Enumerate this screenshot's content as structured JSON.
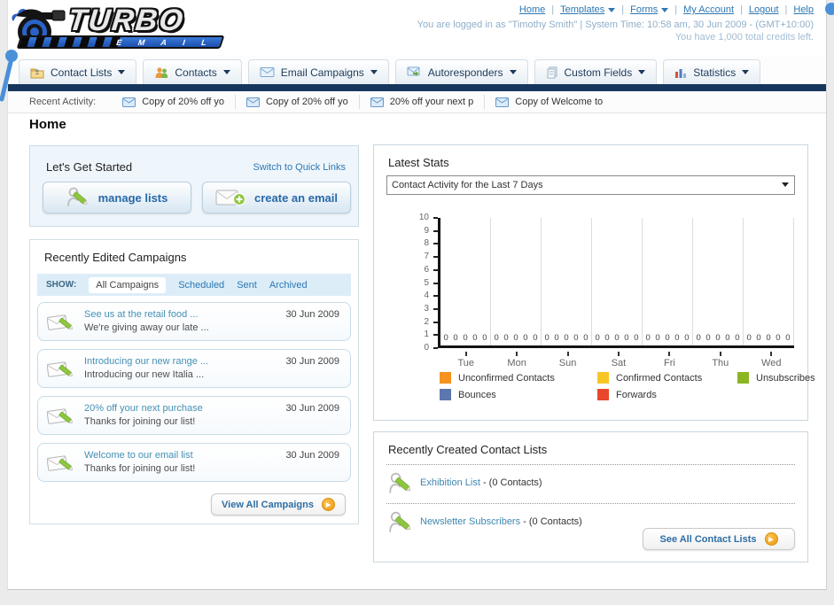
{
  "header": {
    "logo": {
      "line1": "TURBO",
      "line2": "E M A I L"
    },
    "nav": [
      {
        "label": "Home",
        "dropdown": false
      },
      {
        "label": "Templates",
        "dropdown": true
      },
      {
        "label": "Forms",
        "dropdown": true
      },
      {
        "label": "My Account",
        "dropdown": false
      },
      {
        "label": "Logout",
        "dropdown": false
      },
      {
        "label": "Help",
        "dropdown": false
      }
    ],
    "login_info": "You are logged in as \"Timothy Smith\" | System Time: 10:58 am, 30 Jun 2009 - (GMT+10:00)",
    "credits_info": "You have 1,000 total credits left."
  },
  "tabs": [
    {
      "label": "Contact Lists"
    },
    {
      "label": "Contacts"
    },
    {
      "label": "Email Campaigns"
    },
    {
      "label": "Autoresponders"
    },
    {
      "label": "Custom Fields"
    },
    {
      "label": "Statistics"
    }
  ],
  "recent_activity": {
    "label": "Recent Activity:",
    "items": [
      "Copy of 20% off yo",
      "Copy of 20% off yo",
      "20% off your next p",
      "Copy of Welcome to"
    ]
  },
  "page_title": "Home",
  "get_started": {
    "title": "Let's Get Started",
    "switch_link": "Switch to Quick Links",
    "buttons": [
      {
        "label": "manage lists"
      },
      {
        "label": "create an email"
      }
    ]
  },
  "campaigns": {
    "title": "Recently Edited Campaigns",
    "show_label": "SHOW:",
    "filters": [
      "All Campaigns",
      "Scheduled",
      "Sent",
      "Archived"
    ],
    "active_filter": "All Campaigns",
    "items": [
      {
        "title": "See us at the retail food ...",
        "subtitle": "We're giving away our late ...",
        "date": "30 Jun 2009"
      },
      {
        "title": "Introducing our new range ...",
        "subtitle": "Introducing our new Italia ...",
        "date": "30 Jun 2009"
      },
      {
        "title": "20% off your next purchase",
        "subtitle": "Thanks for joining our list!",
        "date": "30 Jun 2009"
      },
      {
        "title": "Welcome to our email list",
        "subtitle": "Thanks for joining our list!",
        "date": "30 Jun 2009"
      }
    ],
    "view_all": "View All Campaigns"
  },
  "stats": {
    "title": "Latest Stats",
    "dropdown_value": "Contact Activity for the Last 7 Days"
  },
  "chart_data": {
    "type": "bar",
    "title": "Contact Activity for the Last 7 Days",
    "categories": [
      "Tue",
      "Mon",
      "Sun",
      "Sat",
      "Fri",
      "Thu",
      "Wed"
    ],
    "series": [
      {
        "name": "Unconfirmed Contacts",
        "color": "#F6921E",
        "values": [
          0,
          0,
          0,
          0,
          0,
          0,
          0
        ]
      },
      {
        "name": "Confirmed Contacts",
        "color": "#F8C527",
        "values": [
          0,
          0,
          0,
          0,
          0,
          0,
          0
        ]
      },
      {
        "name": "Unsubscribes",
        "color": "#8CB524",
        "values": [
          0,
          0,
          0,
          0,
          0,
          0,
          0
        ]
      },
      {
        "name": "Bounces",
        "color": "#5C77AE",
        "values": [
          0,
          0,
          0,
          0,
          0,
          0,
          0
        ]
      },
      {
        "name": "Forwards",
        "color": "#E8472B",
        "values": [
          0,
          0,
          0,
          0,
          0,
          0,
          0
        ]
      }
    ],
    "xlabel": "",
    "ylabel": "",
    "ylim": [
      0,
      10
    ],
    "y_ticks": [
      0,
      1,
      2,
      3,
      4,
      5,
      6,
      7,
      8,
      9,
      10
    ],
    "grid": "vertical",
    "legend_position": "bottom",
    "value_labels_shown": true
  },
  "contact_lists": {
    "title": "Recently Created Contact Lists",
    "items": [
      {
        "name": "Exhibition List",
        "suffix": "- (0 Contacts)"
      },
      {
        "name": "Newsletter Subscribers",
        "suffix": "- (0 Contacts)"
      }
    ],
    "see_all": "See All Contact Lists"
  }
}
